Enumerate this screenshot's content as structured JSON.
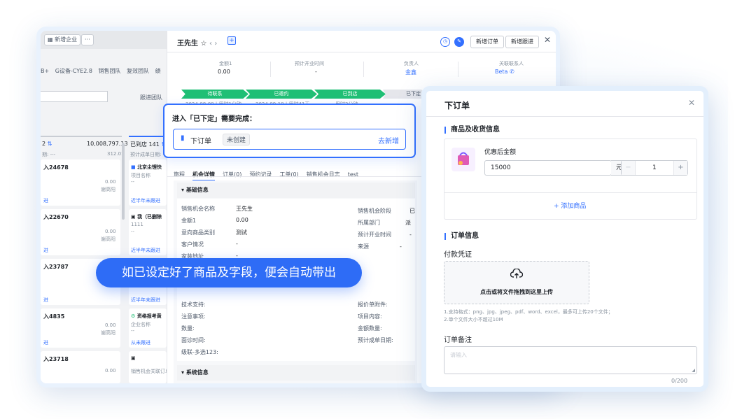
{
  "crm": {
    "topbar": {
      "new_company": "新增企业",
      "more": "···"
    },
    "filters": [
      "B+",
      "G设备-CYE2.8",
      "销售团队",
      "复效团队",
      "绩"
    ],
    "team_follow": "跟进团队",
    "columns": [
      {
        "title": "2",
        "amount": "10,008,797.13",
        "sub": "312.01",
        "sub_label": "期: ---"
      },
      {
        "title": "已到店 141",
        "sub_label": "预计成单日期: ---"
      }
    ],
    "left_cards": [
      {
        "name": "入24678",
        "amount": "0.00",
        "owner": "谢高阳",
        "link": "进"
      },
      {
        "name": "入22670",
        "amount": "0.00",
        "owner": "谢高阳",
        "link": "进"
      },
      {
        "name": "入23787",
        "amount": "",
        "owner": "",
        "link": "进"
      },
      {
        "name": "入4835",
        "amount": "0.00",
        "owner": "谢高阳",
        "link": "进"
      },
      {
        "name": "入23718",
        "amount": "0.00",
        "owner": "",
        "link": ""
      }
    ],
    "mid_cards": [
      {
        "name": "北京尘锂快",
        "line1": "项目名称",
        "line2": "--",
        "link": "近半年未跟进"
      },
      {
        "name": "我（已删除",
        "line1": "1111",
        "line2": "--",
        "link": "近半年未跟进"
      },
      {
        "name": "",
        "line1": "",
        "line2": "",
        "link": "近半年未跟进"
      },
      {
        "name": "资格报考黄",
        "line1": "企业名称",
        "line2": "--",
        "link": "从未跟进"
      },
      {
        "name": "",
        "line1": "销售机会关联订单",
        "line2": "",
        "link": ""
      }
    ]
  },
  "detail": {
    "title": "王先生",
    "header_buttons": {
      "new_order": "新增订单",
      "new_follow": "新增跟进"
    },
    "stats": [
      {
        "label": "金额1",
        "value": "0.00"
      },
      {
        "label": "预计开业时间",
        "value": "-"
      },
      {
        "label": "负责人",
        "value": "金鑫"
      },
      {
        "label": "关联联系人",
        "value": "Beta"
      }
    ],
    "stages": [
      {
        "name": "待联系",
        "date": "2024-08-09 | 用时1分钟"
      },
      {
        "name": "已邀约",
        "date": "2024-09-19 | 用时41天"
      },
      {
        "name": "已到店",
        "date": "用时2分钟"
      },
      {
        "name": "已下定",
        "date": ""
      }
    ],
    "tabs": [
      "旅程",
      "机会详情",
      "订单(0)",
      "预约记录",
      "工单(0)",
      "销售机会日志",
      "test"
    ],
    "basic_section": "基础信息",
    "fields_left": [
      {
        "label": "销售机会名称",
        "value": "王先生"
      },
      {
        "label": "金额1",
        "value": "0.00"
      },
      {
        "label": "意向商品类别",
        "value": "测试"
      },
      {
        "label": "客户情况",
        "value": "-"
      },
      {
        "label": "家装地址",
        "value": "-"
      }
    ],
    "fields_right": [
      {
        "label": "销售机会阶段",
        "value": "已"
      },
      {
        "label": "所属部门",
        "value": "派"
      },
      {
        "label": "预计开业时间",
        "value": "-"
      },
      {
        "label": "来源",
        "value": "-"
      }
    ],
    "extra_left": [
      "技术支持:",
      "注意事项:",
      "数量:",
      "面诊时间:",
      "级联-多选123:"
    ],
    "extra_right": [
      "报价单附件:",
      "项目内容:",
      "金额数量:",
      "预计成单日期:"
    ],
    "system_section": "系统信息"
  },
  "callout": {
    "title": "进入「已下定」需要完成：",
    "task": "下订单",
    "status": "未创建",
    "action": "去新增"
  },
  "banner": "如已设定好了商品及字段，便会自动带出",
  "order": {
    "title": "下订单",
    "goods_section": "商品及收货信息",
    "price_label": "优惠后金额",
    "price_value": "15000",
    "unit": "元",
    "qty": "1",
    "add_goods": "+ 添加商品",
    "order_section": "订单信息",
    "proof_label": "付款凭证",
    "upload_text": "点击或将文件拖拽到这里上传",
    "upload_hint1": "1.支持格式：png、jpg、jpeg、pdf、word、excel，最多可上传20个文件；",
    "upload_hint2": "2.单个文件大小不超过10M",
    "remark_label": "订单备注",
    "remark_placeholder": "请输入",
    "remark_count": "0/200"
  },
  "colors": {
    "accent": "#3370ff",
    "stage_done": "#1fbf75",
    "banner": "#2e6cf6"
  }
}
